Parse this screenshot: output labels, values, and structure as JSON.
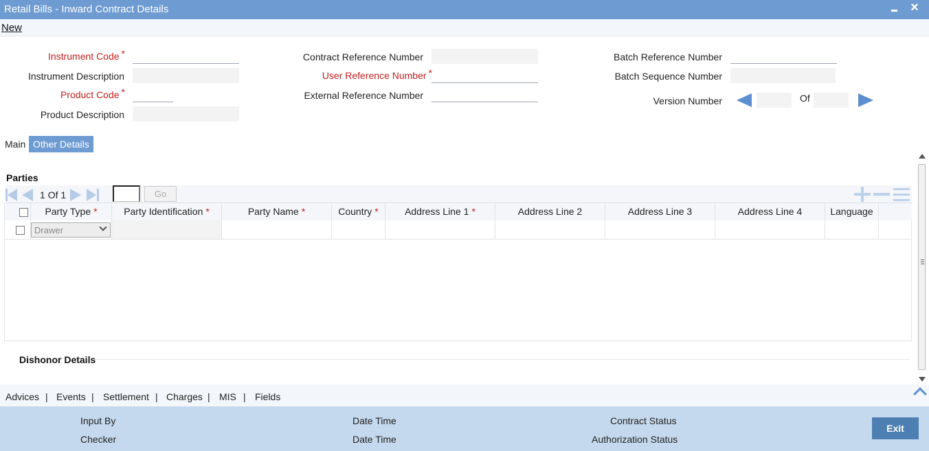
{
  "window": {
    "title": "Retail Bills - Inward Contract Details"
  },
  "menu": {
    "new_label": "New"
  },
  "header_fields": {
    "instrument_code": {
      "label": "Instrument Code",
      "value": ""
    },
    "instrument_description": {
      "label": "Instrument Description",
      "value": ""
    },
    "product_code": {
      "label": "Product Code",
      "value": ""
    },
    "product_description": {
      "label": "Product Description",
      "value": ""
    },
    "contract_reference_number": {
      "label": "Contract Reference Number",
      "value": ""
    },
    "user_reference_number": {
      "label": "User Reference Number",
      "value": ""
    },
    "external_reference_number": {
      "label": "External Reference Number",
      "value": ""
    },
    "batch_reference_number": {
      "label": "Batch Reference Number",
      "value": ""
    },
    "batch_sequence_number": {
      "label": "Batch Sequence Number",
      "value": ""
    },
    "version_number": {
      "label": "Version Number",
      "of_label": "Of",
      "current": "",
      "total": ""
    }
  },
  "required_mark": "*",
  "tabs": [
    {
      "label": "Main",
      "active": false
    },
    {
      "label": "Other Details",
      "active": true
    }
  ],
  "parties": {
    "title": "Parties",
    "pager": {
      "current": "1",
      "of_label": "Of",
      "total": "1",
      "go_label": "Go"
    },
    "columns": [
      {
        "label": "Party Type",
        "required": true
      },
      {
        "label": "Party Identification",
        "required": true
      },
      {
        "label": "Party Name",
        "required": true
      },
      {
        "label": "Country",
        "required": true
      },
      {
        "label": "Address Line 1",
        "required": true
      },
      {
        "label": "Address Line 2",
        "required": false
      },
      {
        "label": "Address Line 3",
        "required": false
      },
      {
        "label": "Address Line 4",
        "required": false
      },
      {
        "label": "Language",
        "required": false
      }
    ],
    "rows": [
      {
        "party_type": "Drawer",
        "party_identification": "",
        "party_name": "",
        "country": "",
        "address_line_1": "",
        "address_line_2": "",
        "address_line_3": "",
        "address_line_4": "",
        "language": ""
      }
    ]
  },
  "dishonor": {
    "title": "Dishonor Details"
  },
  "bottom_links": [
    "Advices",
    "Events",
    "Settlement",
    "Charges",
    "MIS",
    "Fields"
  ],
  "footer": {
    "input_by_label": "Input By",
    "checker_label": "Checker",
    "date_time_label": "Date Time",
    "contract_status_label": "Contract Status",
    "authorization_status_label": "Authorization Status",
    "exit_label": "Exit"
  },
  "colors": {
    "title_bar": "#6e9bd1",
    "accent": "#5b8fd0",
    "required": "#c41e1e",
    "footer": "#c5d9ee",
    "exit_button": "#4e7fb3"
  }
}
